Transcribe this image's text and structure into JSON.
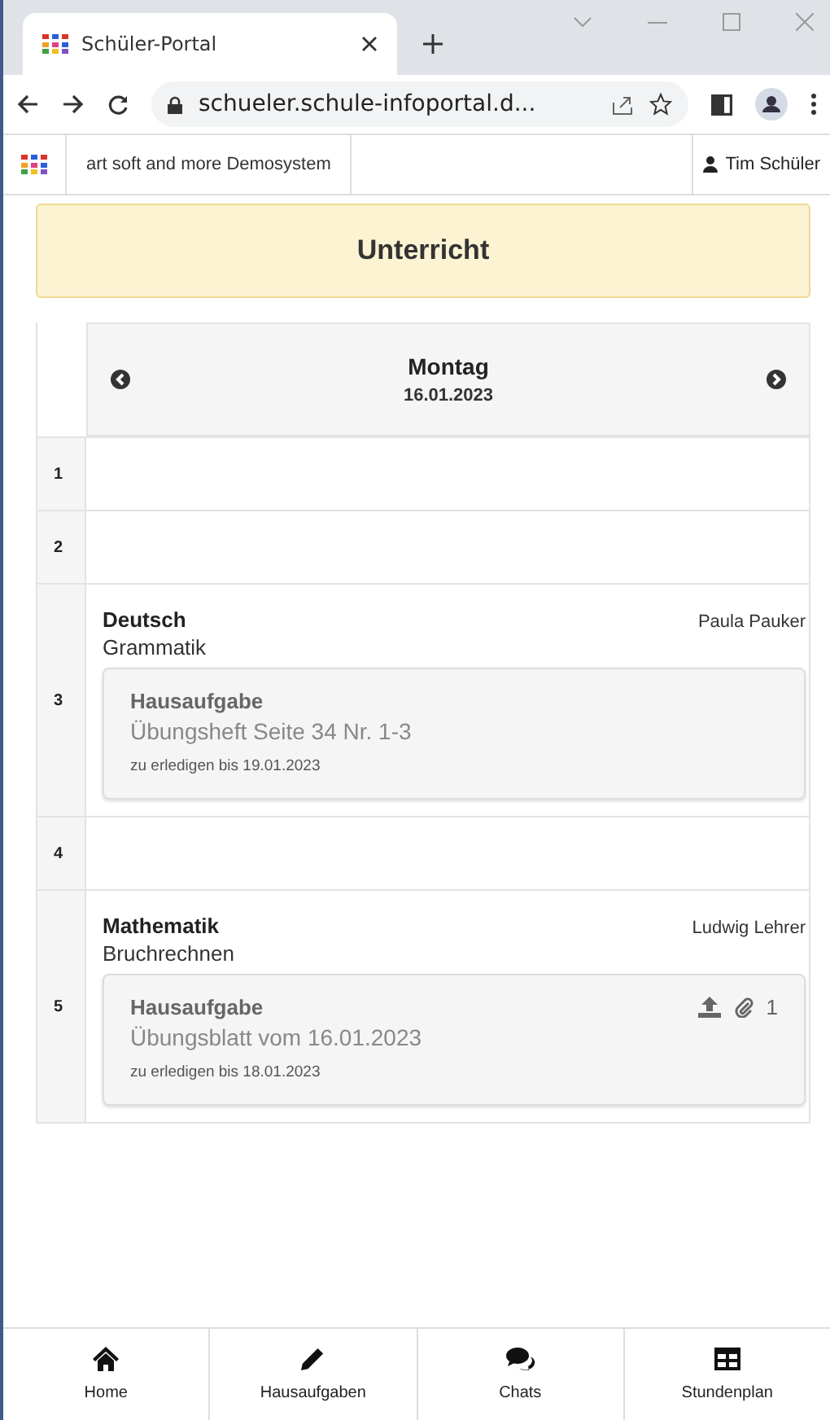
{
  "browser": {
    "tab_title": "Schüler-Portal",
    "url": "schueler.schule-infoportal.d..."
  },
  "app_bar": {
    "system": "art soft and more Demosystem",
    "user": "Tim Schüler"
  },
  "title": "Unterricht",
  "day": {
    "weekday": "Montag",
    "date": "16.01.2023"
  },
  "periods": [
    {
      "number": "1"
    },
    {
      "number": "2"
    },
    {
      "number": "3",
      "subject": "Deutsch",
      "topic": "Grammatik",
      "teacher": "Paula Pauker",
      "homework": {
        "title": "Hausaufgabe",
        "text": "Übungsheft Seite 34 Nr. 1-3",
        "due": "zu erledigen bis 19.01.2023"
      }
    },
    {
      "number": "4"
    },
    {
      "number": "5",
      "subject": "Mathematik",
      "topic": "Bruchrechnen",
      "teacher": "Ludwig Lehrer",
      "homework": {
        "title": "Hausaufgabe",
        "text": "Übungsblatt vom 16.01.2023",
        "due": "zu erledigen bis 18.01.2023",
        "attachments": "1"
      }
    }
  ],
  "nav": [
    {
      "kind": "home",
      "label": "Home"
    },
    {
      "kind": "homework",
      "label": "Hausaufgaben"
    },
    {
      "kind": "chats",
      "label": "Chats"
    },
    {
      "kind": "timetable",
      "label": "Stundenplan"
    }
  ]
}
